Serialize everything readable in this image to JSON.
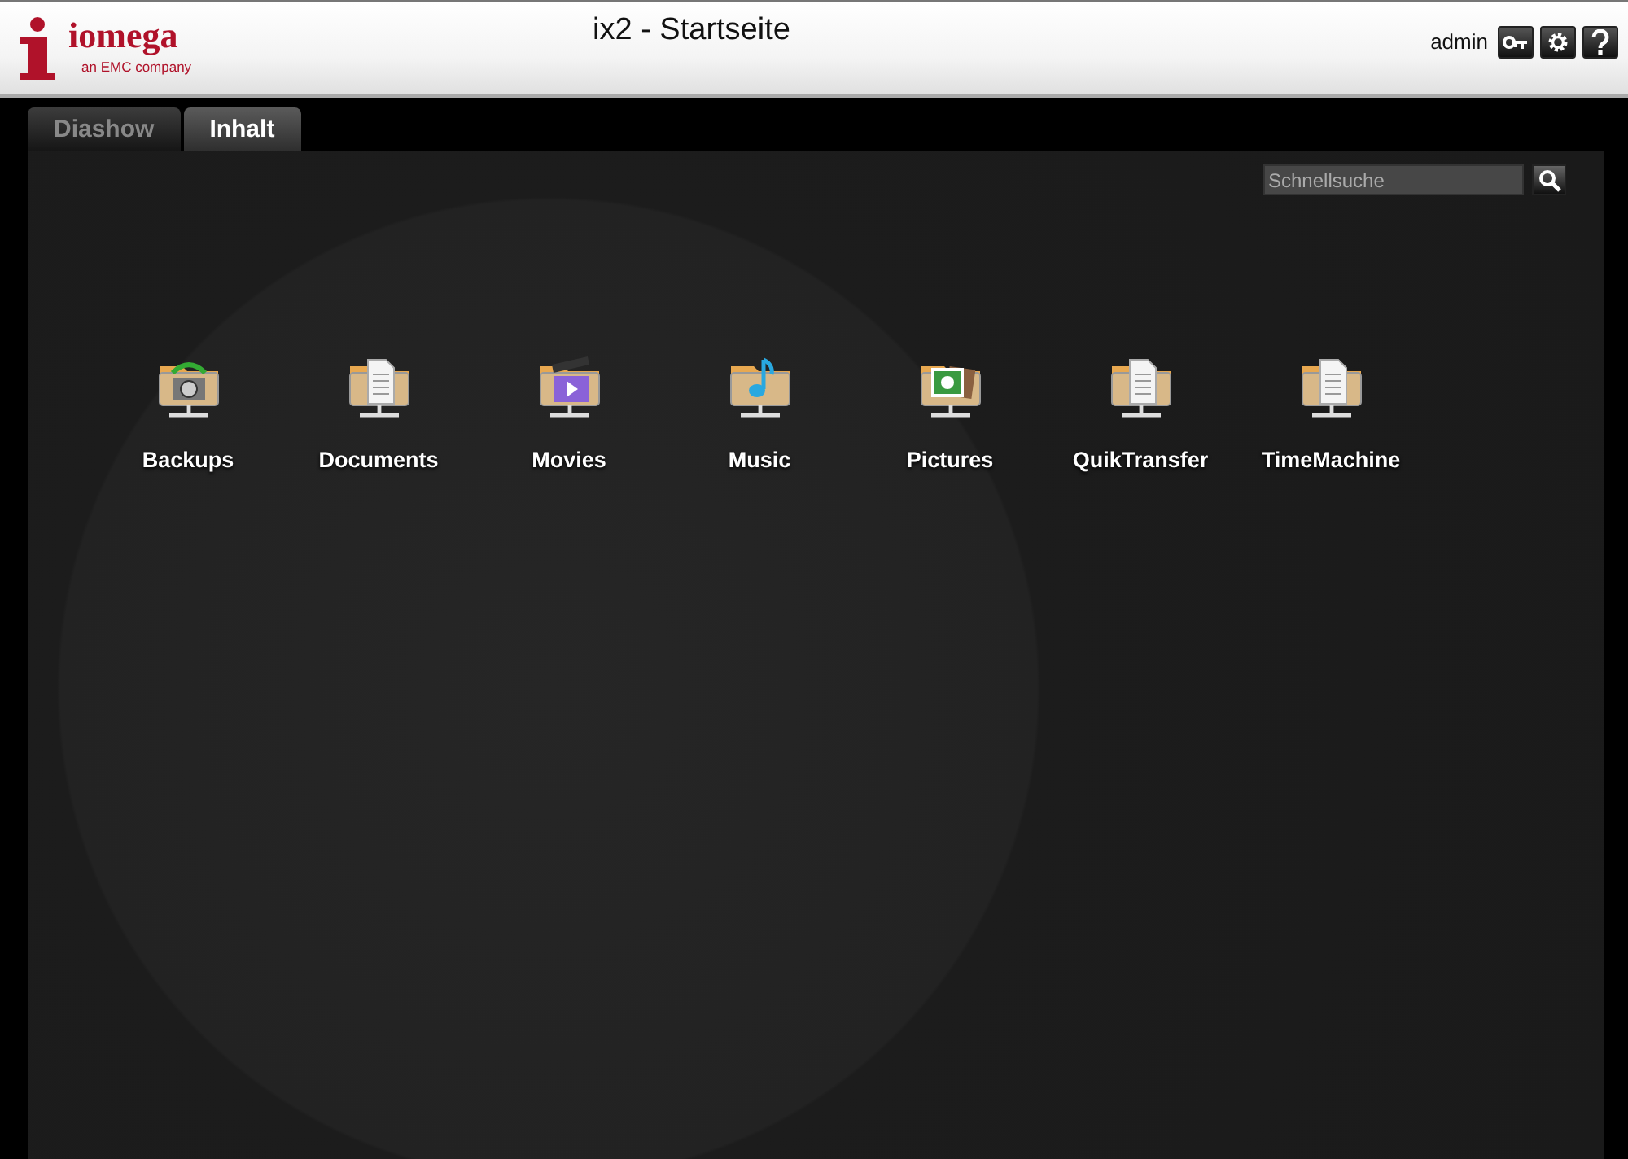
{
  "header": {
    "logo": {
      "name": "iomega",
      "tagline": "an EMC company"
    },
    "title": "ix2 - Startseite",
    "user": "admin"
  },
  "tabs": [
    {
      "label": "Diashow",
      "selected": false
    },
    {
      "label": "Inhalt",
      "selected": true
    }
  ],
  "search": {
    "placeholder": "Schnellsuche"
  },
  "shares": [
    {
      "label": "Backups",
      "kind": "backup"
    },
    {
      "label": "Documents",
      "kind": "document"
    },
    {
      "label": "Movies",
      "kind": "movie"
    },
    {
      "label": "Music",
      "kind": "music"
    },
    {
      "label": "Pictures",
      "kind": "picture"
    },
    {
      "label": "QuikTransfer",
      "kind": "document"
    },
    {
      "label": "TimeMachine",
      "kind": "document"
    }
  ]
}
